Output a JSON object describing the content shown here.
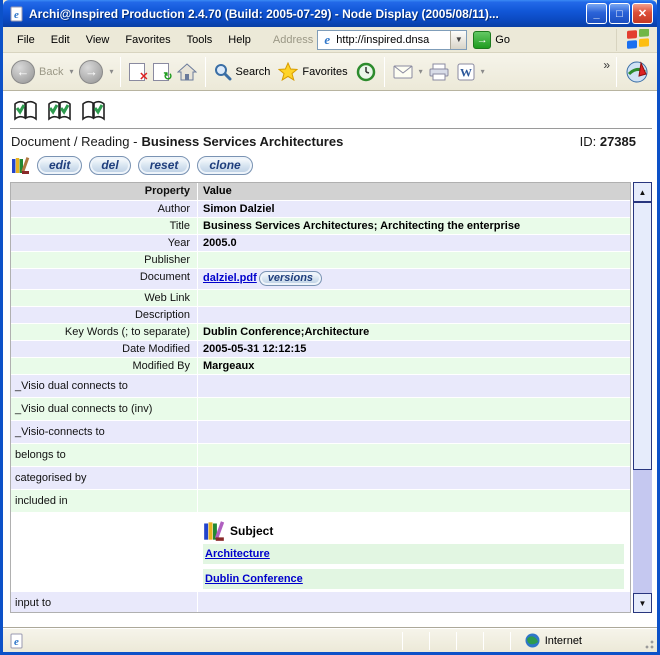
{
  "window": {
    "title": "Archi@Inspired Production 2.4.70 (Build: 2005-07-29) - Node Display (2005/08/11)...",
    "minimize_glyph": "_",
    "maximize_glyph": "□",
    "close_glyph": "✕"
  },
  "menu": {
    "items": [
      "File",
      "Edit",
      "View",
      "Favorites",
      "Tools",
      "Help"
    ]
  },
  "address_bar": {
    "label": "Address",
    "url": "http://inspired.dnsa",
    "dropdown_glyph": "▼",
    "go_arrow": "→",
    "go_label": "Go"
  },
  "toolbar": {
    "back_label": "Back",
    "back_arrow": "←",
    "forward_arrow": "→",
    "stop_glyph": "✕",
    "refresh_glyph": "↻",
    "search_label": "Search",
    "favorites_label": "Favorites",
    "dropdown_glyph": "▾",
    "chevron_glyph": "»",
    "word_glyph": "W"
  },
  "page": {
    "breadcrumb": "Document / Reading -",
    "title": "Business Services Architectures",
    "id_label": "ID:",
    "id_value": "27385",
    "actions": [
      "edit",
      "del",
      "reset",
      "clone"
    ]
  },
  "table": {
    "header": {
      "property": "Property",
      "value": "Value"
    },
    "rows": [
      {
        "property": "Author",
        "value": "Simon Dalziel",
        "tone": "blue"
      },
      {
        "property": "Title",
        "value": "Business Services Architectures; Architecting the enterprise",
        "tone": "green"
      },
      {
        "property": "Year",
        "value": "2005.0",
        "tone": "blue"
      },
      {
        "property": "Publisher",
        "value": "",
        "tone": "green"
      },
      {
        "property": "Document",
        "link": "dalziel.pdf",
        "button": "versions",
        "tone": "blue"
      },
      {
        "property": "Web Link",
        "value": "",
        "tone": "green"
      },
      {
        "property": "Description",
        "value": "",
        "tone": "blue"
      },
      {
        "property": "Key Words (; to separate)",
        "value": "Dublin Conference;Architecture",
        "tone": "green"
      },
      {
        "property": "Date Modified",
        "value": "2005-05-31 12:12:15",
        "tone": "blue"
      },
      {
        "property": "Modified By",
        "value": "Margeaux",
        "tone": "green"
      },
      {
        "property": "_Visio dual connects to",
        "value": "",
        "tone": "blue",
        "tall": true
      },
      {
        "property": "_Visio dual connects to (inv)",
        "value": "",
        "tone": "green",
        "tall": true
      },
      {
        "property": "_Visio-connects to",
        "value": "",
        "tone": "blue",
        "tall": true
      },
      {
        "property": "belongs to",
        "value": "",
        "tone": "green",
        "tall": true
      },
      {
        "property": "categorised by",
        "value": "",
        "tone": "blue",
        "tall": true
      },
      {
        "property": "included in",
        "value": "",
        "tone": "green",
        "tall": true
      }
    ],
    "subject_block": {
      "heading": "Subject",
      "links": [
        "Architecture",
        "Dublin Conference"
      ]
    },
    "last_row": {
      "property": "input to",
      "value": "",
      "tone": "blue",
      "tall": true
    }
  },
  "scrollbar": {
    "up_glyph": "▲",
    "down_glyph": "▼"
  },
  "status_bar": {
    "zone_label": "Internet"
  },
  "colors": {
    "row_blue": "#e9e9fb",
    "row_green": "#e9fbe9",
    "header_gray": "#d2d2d2",
    "link_blue": "#0000cc",
    "titlebar_blue": "#1257d8",
    "menubar_tan": "#ece9d8",
    "scroll_track_lavender": "#c5c8f0",
    "scroll_face": "#e6ecfb"
  }
}
